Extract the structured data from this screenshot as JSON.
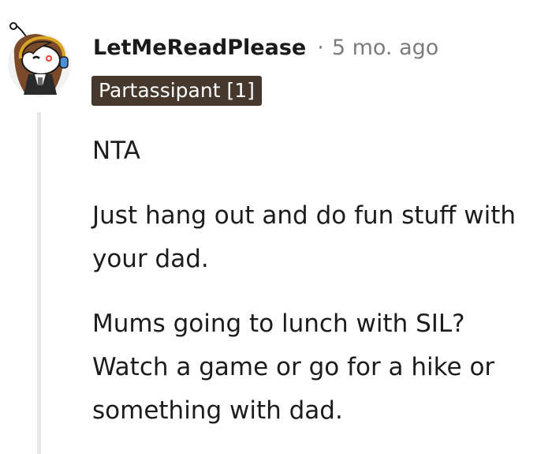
{
  "comment": {
    "username": "LetMeReadPlease",
    "separator": "·",
    "age": "5 mo. ago",
    "flair": "Partassipant [1]",
    "paragraphs": [
      "NTA",
      "Just hang out and do fun stuff with your dad.",
      "Mums going to lunch with SIL? Watch a game or go for a hike or something with dad."
    ],
    "avatar_icon": "snoo-avatar-icon"
  },
  "colors": {
    "flair_bg": "#46382c",
    "meta_text": "#7c7c7c",
    "thread_line": "#e7e7e7"
  }
}
